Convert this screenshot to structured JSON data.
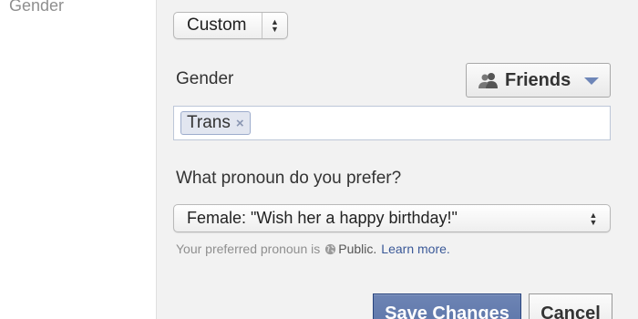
{
  "left_label": "Gender",
  "audience_select": {
    "value": "Custom",
    "icon": "up-down-arrows-icon"
  },
  "gender": {
    "label": "Gender",
    "privacy_button": {
      "label": "Friends",
      "icon": "friends-icon",
      "caret_icon": "caret-down-icon",
      "caret_color": "#6e86b8"
    },
    "tokens": [
      {
        "label": "Trans",
        "remove_glyph": "×"
      }
    ]
  },
  "pronoun": {
    "question": "What pronoun do you prefer?",
    "selected": "Female: \"Wish her a happy birthday!\"",
    "note": {
      "prefix": "Your preferred pronoun is",
      "icon": "globe-icon",
      "audience": "Public.",
      "link": "Learn more."
    }
  },
  "actions": {
    "save_label": "Save Changes",
    "cancel_label": "Cancel"
  },
  "colors": {
    "panel_bg": "#f2f2f2",
    "primary_button": "#5b74a8",
    "link": "#3b5998",
    "token_bg": "#e2e6f0"
  }
}
